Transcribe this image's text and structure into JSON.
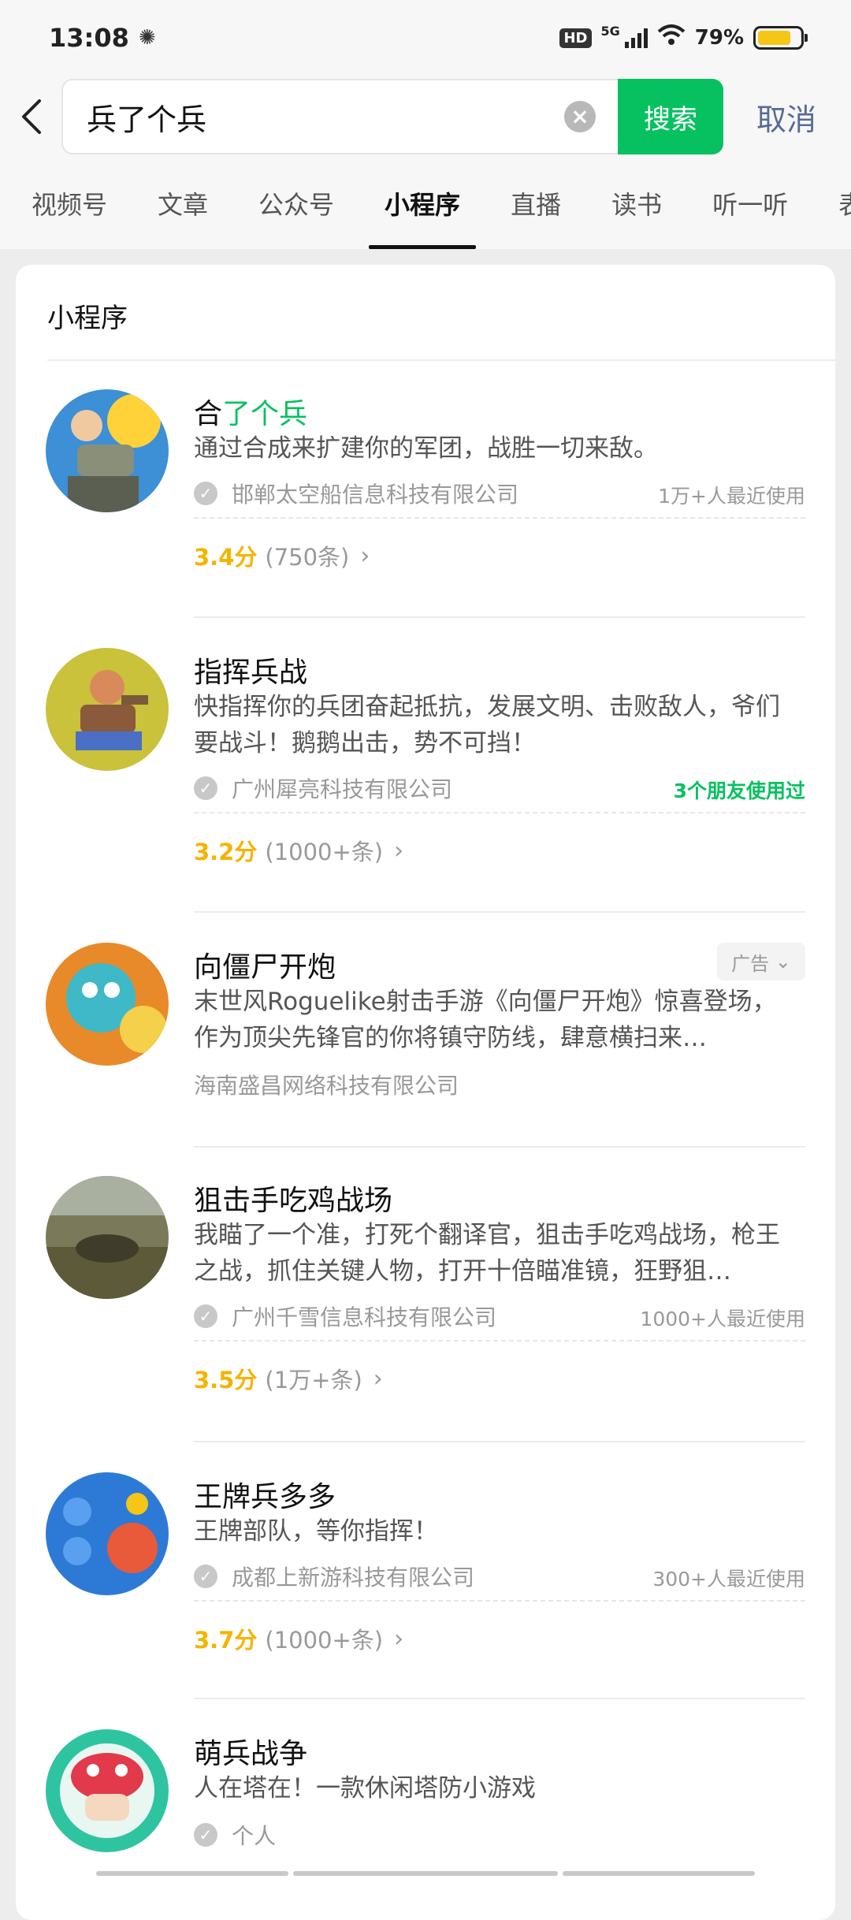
{
  "status": {
    "time": "13:08",
    "hd": "HD",
    "network": "5G",
    "battery": "79%",
    "battery_level": 0.79
  },
  "search": {
    "query": "兵了个兵",
    "button": "搜索",
    "cancel": "取消",
    "back_icon": "chevron-left-icon"
  },
  "tabs": [
    {
      "label": "视频号"
    },
    {
      "label": "文章"
    },
    {
      "label": "公众号"
    },
    {
      "label": "小程序",
      "active": true
    },
    {
      "label": "直播"
    },
    {
      "label": "读书"
    },
    {
      "label": "听一听"
    },
    {
      "label": "表"
    }
  ],
  "section": {
    "title": "小程序"
  },
  "results": [
    {
      "name_plain": "合",
      "name_highlight": "了个兵",
      "desc": "通过合成来扩建你的军团，战胜一切来敌。",
      "company": "邯郸太空船信息科技有限公司",
      "usage": "1万+人最近使用",
      "score": "3.4分",
      "count": "(750条)"
    },
    {
      "name": "指挥兵战",
      "desc": "快指挥你的兵团奋起抵抗，发展文明、击败敌人，爷们要战斗！鹅鹅出击，势不可挡！",
      "company": "广州犀亮科技有限公司",
      "usage": "3个朋友使用过",
      "score": "3.2分",
      "count": "(1000+条)"
    },
    {
      "name": "向僵尸开炮",
      "ad": "广告",
      "desc": "末世风Roguelike射击手游《向僵尸开炮》惊喜登场，作为顶尖先锋官的你将镇守防线，肆意横扫来…",
      "company": "海南盛昌网络科技有限公司"
    },
    {
      "name": "狙击手吃鸡战场",
      "desc": "我瞄了一个准，打死个翻译官，狙击手吃鸡战场，枪王之战，抓住关键人物，打开十倍瞄准镜，狂野狙…",
      "company": "广州千雪信息科技有限公司",
      "usage": "1000+人最近使用",
      "score": "3.5分",
      "count": "(1万+条)"
    },
    {
      "name": "王牌兵多多",
      "desc": "王牌部队，等你指挥！",
      "company": "成都上新游科技有限公司",
      "usage": "300+人最近使用",
      "score": "3.7分",
      "count": "(1000+条)"
    },
    {
      "name": "萌兵战争",
      "desc": "人在塔在！一款休闲塔防小游戏",
      "company": "个人"
    }
  ]
}
